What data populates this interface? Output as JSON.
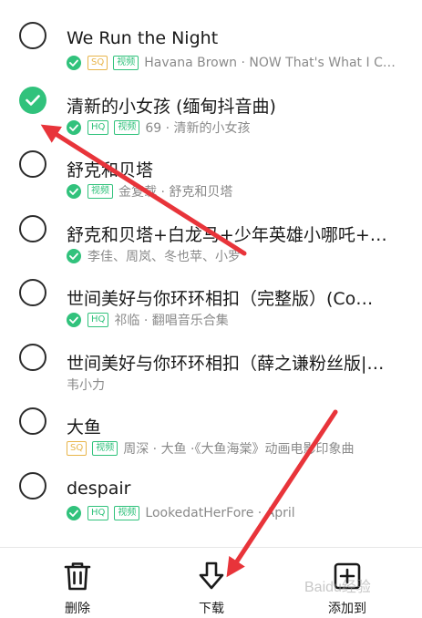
{
  "songs": [
    {
      "title": "We Run the Night",
      "checked": false,
      "downloaded": true,
      "badges": [
        "SQ",
        "视频"
      ],
      "meta": "Havana Brown · NOW That's What I C…"
    },
    {
      "title": "清新的小女孩 (缅甸抖音曲)",
      "checked": true,
      "downloaded": true,
      "badges": [
        "HQ",
        "视频"
      ],
      "meta": "69 · 清新的小女孩"
    },
    {
      "title": "舒克和贝塔",
      "checked": false,
      "downloaded": true,
      "badges": [
        "视频"
      ],
      "meta": "金复载 · 舒克和贝塔"
    },
    {
      "title": "舒克和贝塔+白龙马+少年英雄小哪吒+…",
      "checked": false,
      "downloaded": true,
      "badges": [],
      "meta": "李佳、周岚、冬也苹、小罗"
    },
    {
      "title": "世间美好与你环环相扣（完整版）(Co…",
      "checked": false,
      "downloaded": true,
      "badges": [
        "HQ"
      ],
      "meta": "祁临 · 翻唱音乐合集"
    },
    {
      "title": "世间美好与你环环相扣（薛之谦粉丝版|…",
      "checked": false,
      "downloaded": false,
      "badges": [],
      "meta": "韦小力"
    },
    {
      "title": "大鱼",
      "checked": false,
      "downloaded": false,
      "badges": [
        "SQ",
        "视频"
      ],
      "meta": "周深 · 大鱼 ·《大鱼海棠》动画电影印象曲"
    },
    {
      "title": "despair",
      "checked": false,
      "downloaded": true,
      "badges": [
        "HQ",
        "视频"
      ],
      "meta": "LookedatHerFore · April"
    }
  ],
  "actions": {
    "delete_label": "删除",
    "download_label": "下载",
    "add_to_label": "添加到"
  },
  "watermark_text": "Baidu经验",
  "colors": {
    "accent": "#31c27c",
    "sq": "#e8b54b",
    "annotation_arrow": "#e8343a"
  },
  "icons": {
    "downloaded": "downloaded-check-icon",
    "checked": "checkmark-icon",
    "delete": "trash-icon",
    "download": "download-arrow-icon",
    "add_to": "add-to-playlist-icon"
  }
}
